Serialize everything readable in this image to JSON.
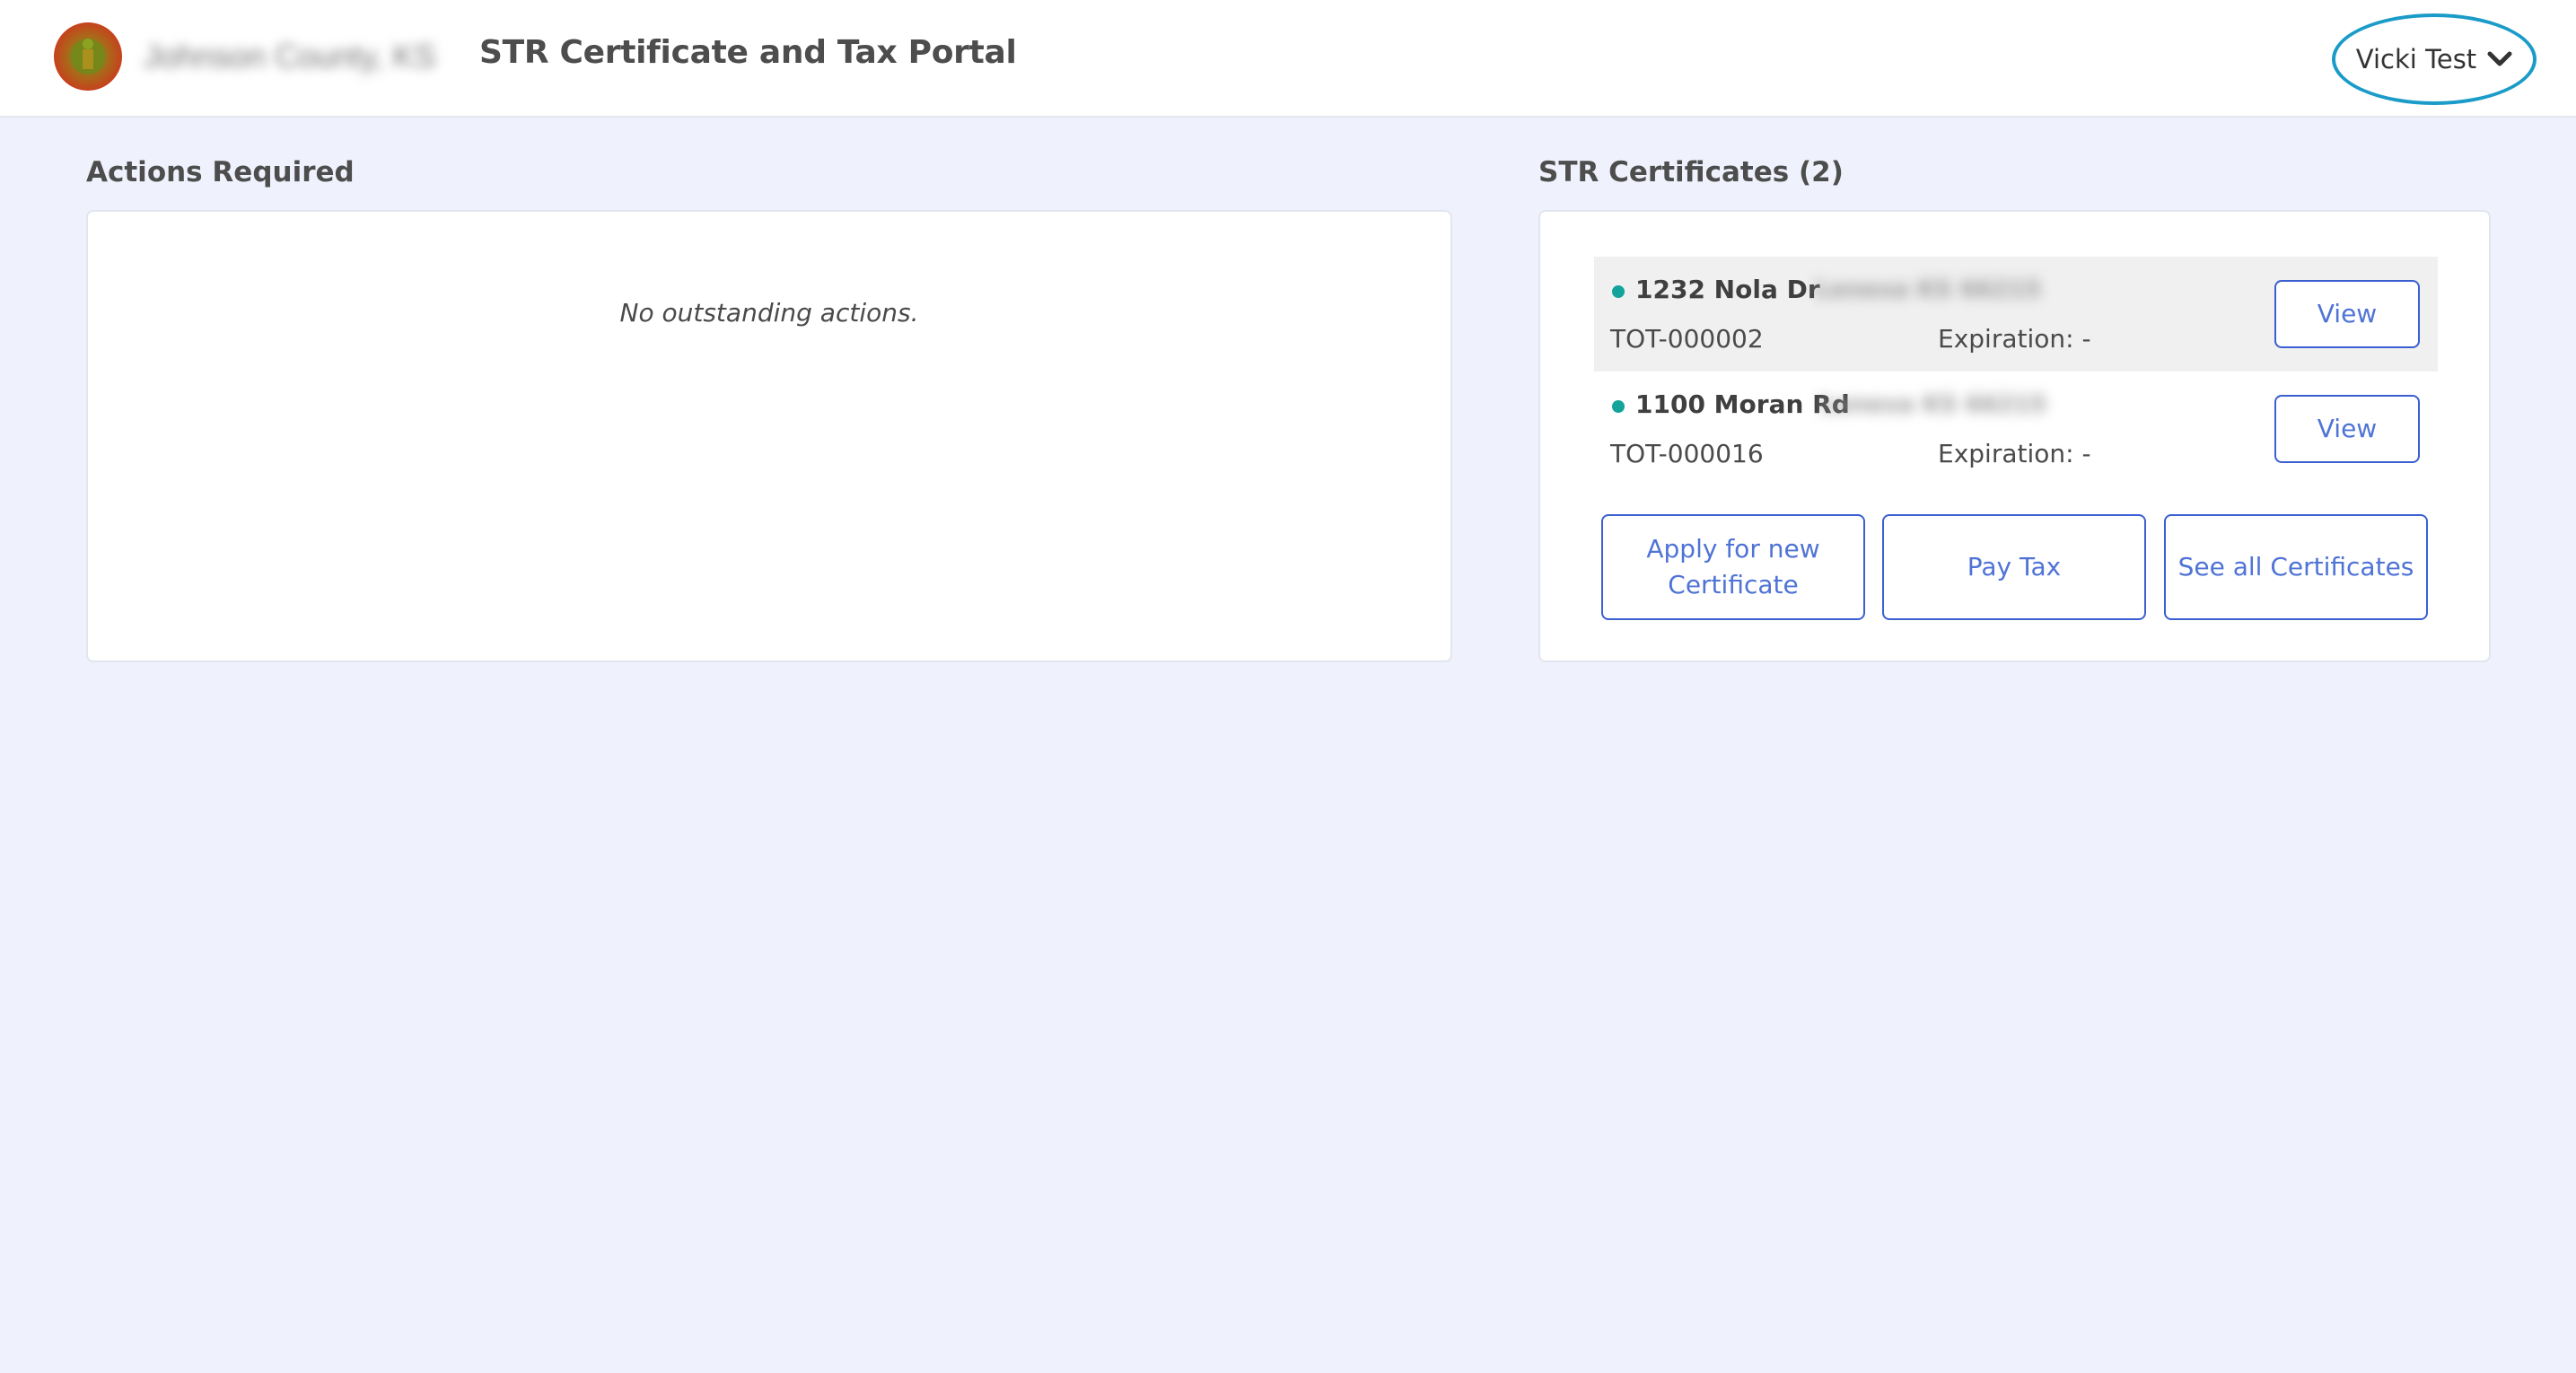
{
  "header": {
    "org_name": "Johnson County, KS",
    "app_title": "STR Certificate and Tax Portal",
    "user_name": "Vicki Test"
  },
  "actions": {
    "title": "Actions Required",
    "empty_message": "No outstanding actions."
  },
  "certificates": {
    "title": "STR Certificates (2)",
    "items": [
      {
        "address": "1232 Nola Dr",
        "address_redacted": "Lenexa KS 66215",
        "id": "TOT-000002",
        "expiration": "Expiration: -",
        "view_label": "View"
      },
      {
        "address": "1100 Moran Rd",
        "address_redacted": "Lenexa KS 66215",
        "id": "TOT-000016",
        "expiration": "Expiration: -",
        "view_label": "View"
      }
    ],
    "buttons": {
      "apply_line1": "Apply for new",
      "apply_line2": "Certificate",
      "pay": "Pay Tax",
      "see_all": "See all Certificates"
    }
  },
  "colors": {
    "page_bg": "#eff2fc",
    "accent_blue": "#4f73d6",
    "status_dot": "#12a39a",
    "user_outline": "#1a9bc8"
  },
  "icons": {
    "logo": "county-seal-logo",
    "user_menu": "chevron-down-icon",
    "status": "status-dot-icon"
  }
}
